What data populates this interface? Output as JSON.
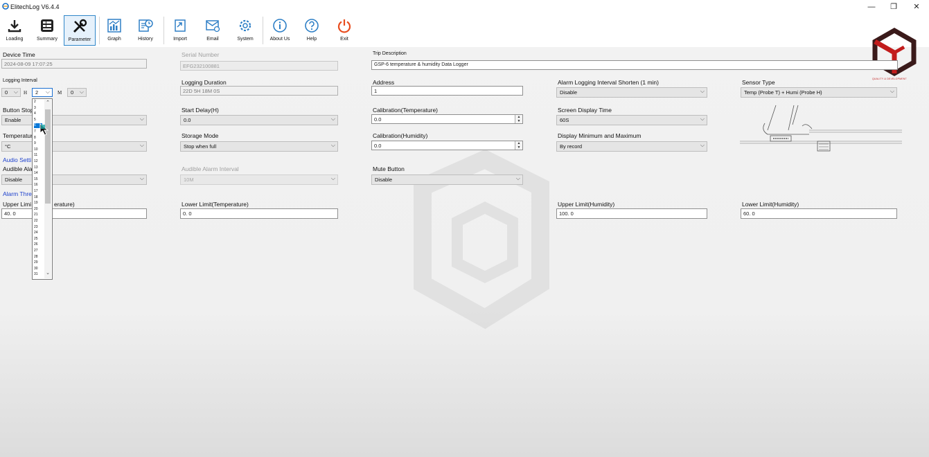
{
  "window": {
    "title": "ElitechLog V6.4.4",
    "controls": [
      "—",
      "❐",
      "✕"
    ]
  },
  "toolbar": {
    "loading": "Loading",
    "summary": "Summary",
    "parameter": "Parameter",
    "graph": "Graph",
    "history": "History",
    "import": "Import",
    "email": "Email",
    "system": "System",
    "about": "About Us",
    "help": "Help",
    "exit": "Exit"
  },
  "form": {
    "device_time": {
      "label": "Device Time",
      "value": "2024-08-09 17:07:25"
    },
    "serial": {
      "label": "Serial Number",
      "value": "EFG232100881"
    },
    "trip": {
      "label": "Trip Description",
      "value": "GSP-6 temperature & humidity Data Logger"
    },
    "logging_interval": {
      "label": "Logging Interval",
      "hour_value": "0",
      "hour_unit": "H",
      "min_value": "2",
      "min_unit": "M",
      "sec_value": "0"
    },
    "logging_duration": {
      "label": "Logging Duration",
      "value": "22D 5H 18M 0S"
    },
    "address": {
      "label": "Address",
      "value": "1"
    },
    "alarm_shorten": {
      "label": "Alarm Logging Interval Shorten (1 min)",
      "value": "Disable"
    },
    "sensor_type": {
      "label": "Sensor Type",
      "value": "Temp (Probe T) + Humi (Probe H)"
    },
    "button_stop": {
      "label": "Button Stop",
      "value": "Enable"
    },
    "start_delay": {
      "label": "Start Delay(H)",
      "value": "0.0"
    },
    "cal_temp": {
      "label": "Calibration(Temperature)",
      "value": "0.0"
    },
    "screen_time": {
      "label": "Screen Display Time",
      "value": "60S"
    },
    "temp_unit": {
      "label": "Temperature",
      "value": "°C"
    },
    "storage_mode": {
      "label": "Storage Mode",
      "value": "Stop when full"
    },
    "cal_humi": {
      "label": "Calibration(Humidity)",
      "value": "0.0"
    },
    "display_minmax": {
      "label": "Display Minimum and Maximum",
      "value": "By record"
    },
    "audio_section": "Audio Setti",
    "audible_alarm": {
      "label": "Audible Ala",
      "value": "Disable"
    },
    "audible_interval": {
      "label": "Audible Alarm Interval",
      "value": "10M"
    },
    "mute_button": {
      "label": "Mute Button",
      "value": "Disable"
    },
    "alarm_section": "Alarm Thre",
    "upper_temp": {
      "label_left": "Upper Limi",
      "label_right": "erature)",
      "value": "40. 0"
    },
    "lower_temp": {
      "label": "Lower Limit(Temperature)",
      "value": "0. 0"
    },
    "upper_humi": {
      "label": "Upper Limit(Humidity)",
      "value": "100. 0"
    },
    "lower_humi": {
      "label": "Lower Limit(Humidity)",
      "value": "60. 0"
    }
  },
  "dropdown": {
    "items": [
      "2",
      "3",
      "4",
      "5",
      "6",
      "7",
      "8",
      "9",
      "10",
      "11",
      "12",
      "13",
      "14",
      "15",
      "16",
      "17",
      "18",
      "19",
      "20",
      "21",
      "22",
      "23",
      "24",
      "25",
      "26",
      "27",
      "28",
      "29",
      "30",
      "31"
    ],
    "highlighted": "6"
  },
  "logo": {
    "tagline": "QUALITY & DEVELOPMENT"
  },
  "colors": {
    "accent": "#2f86c9",
    "toolbar_icon": "#2e7fc6",
    "exit_icon": "#e84c1e",
    "link_blue": "#1a3ecc",
    "logo_red": "#c21c1c"
  }
}
